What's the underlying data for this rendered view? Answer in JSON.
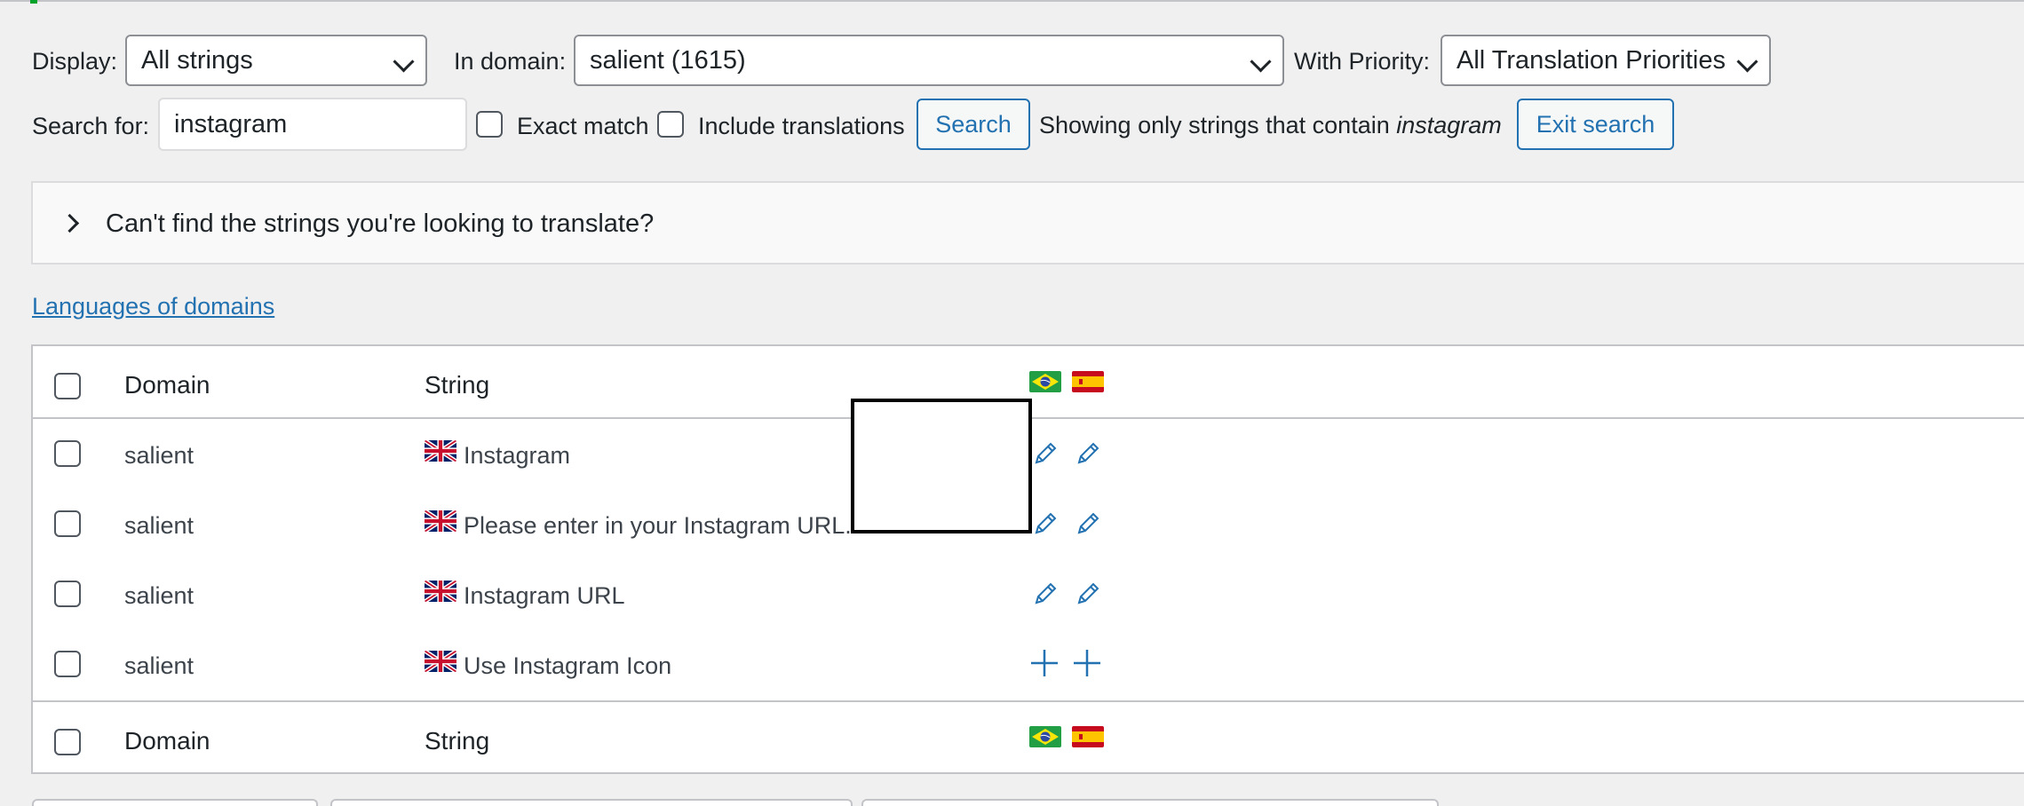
{
  "filters": {
    "display_label": "Display:",
    "display_value": "All strings",
    "domain_label": "In domain:",
    "domain_value": "salient (1615)",
    "priority_label": "With Priority:",
    "priority_value": "All Translation Priorities"
  },
  "search": {
    "label": "Search for:",
    "value": "instagram",
    "exact_match_label": "Exact match",
    "include_translations_label": "Include translations",
    "search_button": "Search",
    "showing_text": "Showing only strings that contain",
    "showing_term": "instagram",
    "exit_button": "Exit search"
  },
  "panel": {
    "title": "Can't find the strings you're looking to translate?"
  },
  "languages_link": "Languages of domains",
  "table": {
    "col_domain": "Domain",
    "col_string": "String",
    "rows": [
      {
        "domain": "salient",
        "string": "Instagram",
        "action": "edit"
      },
      {
        "domain": "salient",
        "string": "Please enter in your Instagram URL.",
        "action": "edit"
      },
      {
        "domain": "salient",
        "string": "Instagram URL",
        "action": "edit"
      },
      {
        "domain": "salient",
        "string": "Use Instagram Icon",
        "action": "add"
      }
    ]
  },
  "icons": {
    "pencil": "pencil-icon",
    "plus": "plus-icon",
    "flag_source": "uk-flag-icon",
    "flag_lang1": "brazil-flag-icon",
    "flag_lang2": "spain-flag-icon"
  },
  "colors": {
    "accent": "#2271b1",
    "background": "#f0f0f1"
  }
}
